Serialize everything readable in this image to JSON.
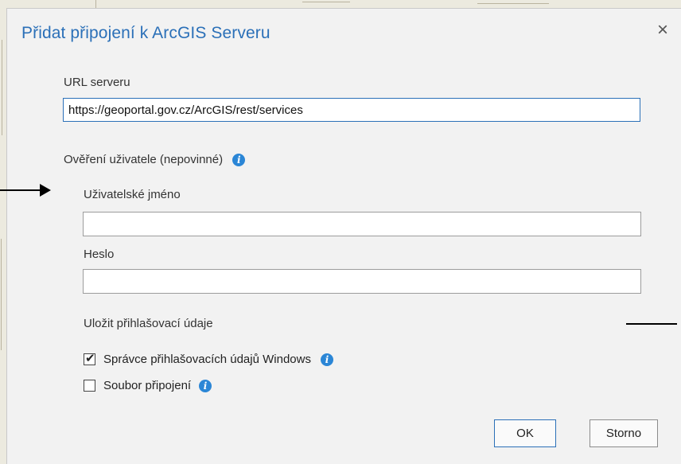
{
  "dialog": {
    "title": "Přidat připojení k ArcGIS Serveru",
    "close_glyph": "×"
  },
  "url": {
    "label": "URL serveru",
    "value": "https://geoportal.gov.cz/ArcGIS/rest/services"
  },
  "auth": {
    "section_label": "Ověření uživatele (nepovinné)",
    "username_label": "Uživatelské jméno",
    "username_value": "",
    "password_label": "Heslo",
    "password_value": "",
    "save_label": "Uložit přihlašovací údaje"
  },
  "options": [
    {
      "label": "Správce přihlašovacích údajů Windows",
      "checked": true
    },
    {
      "label": "Soubor připojení",
      "checked": false
    }
  ],
  "buttons": {
    "ok": "OK",
    "cancel": "Storno"
  },
  "icons": {
    "info": "info-icon",
    "close": "close-icon",
    "check": "check-icon"
  },
  "colors": {
    "accent": "#2b70b8",
    "info": "#2b86d6"
  }
}
